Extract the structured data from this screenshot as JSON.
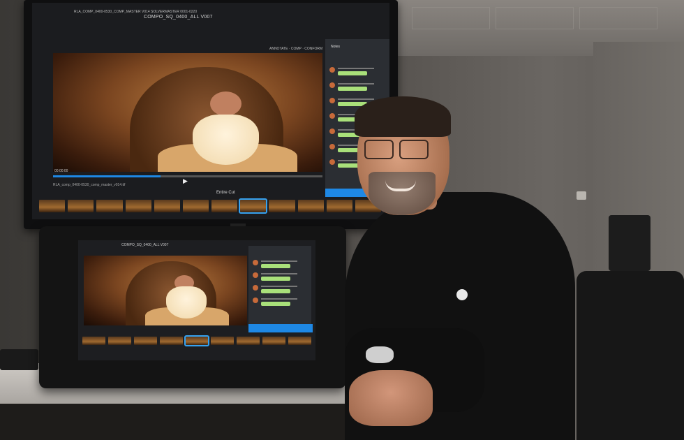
{
  "scene": {
    "tv": {
      "header_title": "COMPO_SQ_0400_ALL V007",
      "header_sub": "RLA_COMP_0400-0530_COMP_MASTER V014 SOLVERMASTER 0001-0220",
      "right_label": "ANNOTATE · COMP · CONFORM",
      "timecode": "00:00:00",
      "clip_name": "RLA_comp_0400-0530_comp_master_v014.tif",
      "edit_label": "Entire Cut",
      "review_title": "Notes"
    },
    "tablet": {
      "header_title": "COMPO_SQ_0400_ALL V007",
      "edit_label": "Entire Cut"
    },
    "colors": {
      "accent_blue": "#1e88e5",
      "bubble_green": "#a9e07a"
    }
  }
}
